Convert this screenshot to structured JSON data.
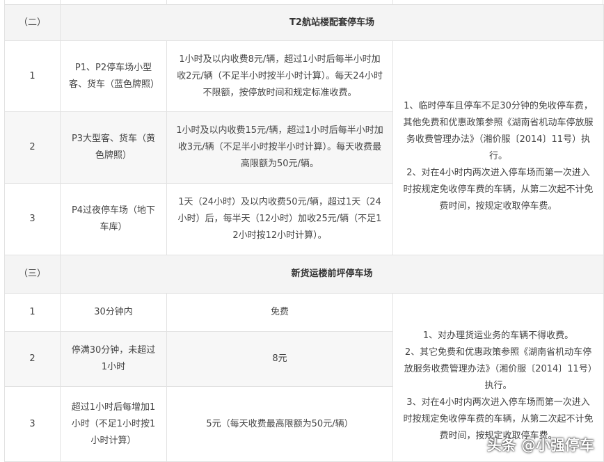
{
  "section2": {
    "index": "（二）",
    "title": "T2航站楼配套停车场",
    "rows": [
      {
        "no": "1",
        "type": "P1、P2停车场小型客、货车（蓝色牌照）",
        "fee": "1小时及以内收费8元/辆，超过1小时后每半小时加收2元/辆（不足半小时按半小时计算）。每天24小时不限额，按停放时间和规定标准收费。"
      },
      {
        "no": "2",
        "type": "P3大型客、货车（黄色牌照）",
        "fee": "1小时及以内收费15元/辆，超过1小时后每半小时加收3元/辆（不足半小时按半小时计算）。每天收费最高限额为50元/辆。"
      },
      {
        "no": "3",
        "type": "P4过夜停车场（地下车库）",
        "fee": "1天（24小时）及以内收费50元/辆，超过1天（24小时）后，每半天（12小时）加收25元/辆（不足12小时按12小时计算）。"
      }
    ],
    "note": "1、临时停车且停车不足30分钟的免收停车费，其他免费和优惠政策参照《湖南省机动车停放服务收费管理办法》（湘价服〔2014〕11号）执行。\n2、对在4小时内两次进入停车场而第一次进入时按规定免收停车费的车辆，从第二次起不计免费时间，按规定收取停车费。"
  },
  "section3": {
    "index": "（三）",
    "title": "新货运楼前坪停车场",
    "rows": [
      {
        "no": "1",
        "type": "30分钟内",
        "fee": "免费"
      },
      {
        "no": "2",
        "type": "停满30分钟，未超过1小时",
        "fee": "8元"
      },
      {
        "no": "3",
        "type": "超过1小时后每增加1小时（不足1小时按1小时计算）",
        "fee": "5元（每天收费最高限额为50元/辆）"
      }
    ],
    "note": "1、对办理货运业务的车辆不得收费。\n2、其它免费和优惠政策参照《湖南省机动车停放服务收费管理办法》（湘价服〔2014〕11号）执行。\n3、对在4小时内两次进入停车场而第一次进入时按规定免收停车费的车辆，从第二次起不计免费时间，按规定收取停车费。"
  },
  "watermark": "头条 @小强停车"
}
